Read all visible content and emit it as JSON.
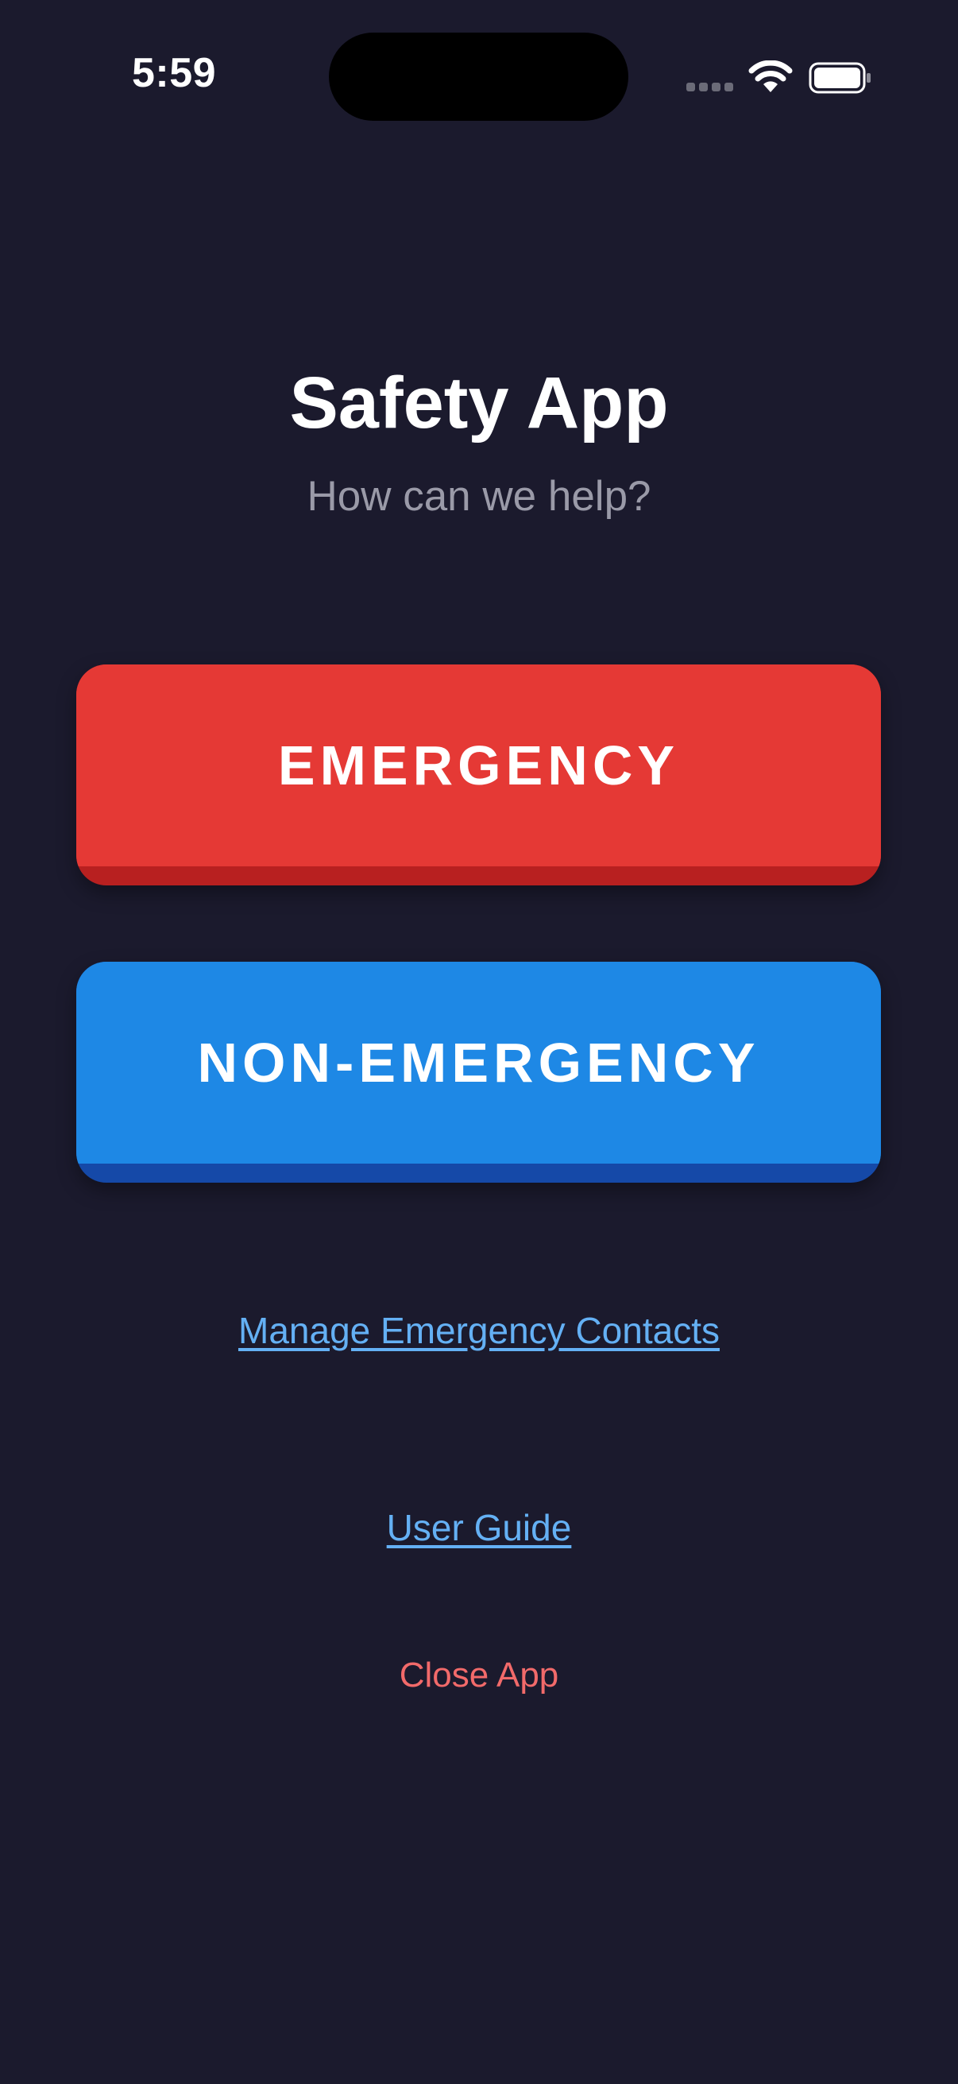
{
  "status_bar": {
    "time": "5:59"
  },
  "header": {
    "title": "Safety App",
    "subtitle": "How can we help?"
  },
  "actions": {
    "emergency_label": "EMERGENCY",
    "non_emergency_label": "NON-EMERGENCY"
  },
  "links": {
    "manage_contacts": "Manage Emergency Contacts",
    "user_guide": "User Guide",
    "close_app": "Close App"
  },
  "colors": {
    "background": "#1b1a2d",
    "emergency": "#e53935",
    "non_emergency": "#1e88e5",
    "link": "#64b0f4",
    "close": "#f26a6a"
  },
  "icons": [
    "signal-icon",
    "wifi-icon",
    "battery-icon"
  ]
}
